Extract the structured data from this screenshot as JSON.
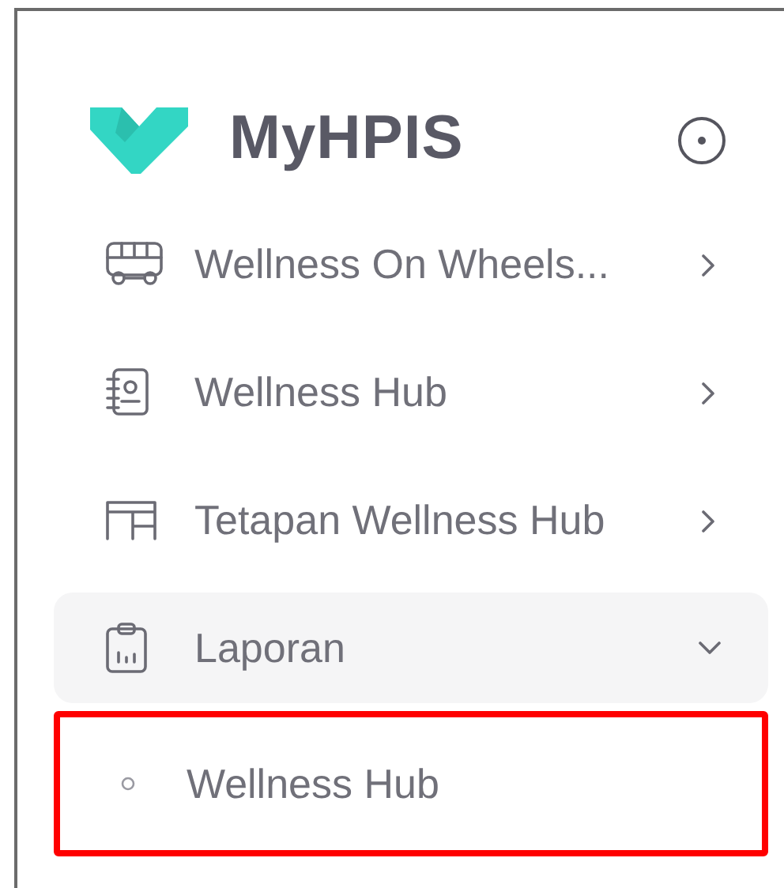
{
  "brand": {
    "name": "MyHPIS"
  },
  "menu": [
    {
      "label": "Wellness On Wheels...",
      "expanded": false
    },
    {
      "label": "Wellness Hub",
      "expanded": false
    },
    {
      "label": "Tetapan Wellness Hub",
      "expanded": false
    },
    {
      "label": "Laporan",
      "expanded": true,
      "children": [
        {
          "label": "Wellness Hub",
          "highlighted": true
        }
      ]
    }
  ]
}
